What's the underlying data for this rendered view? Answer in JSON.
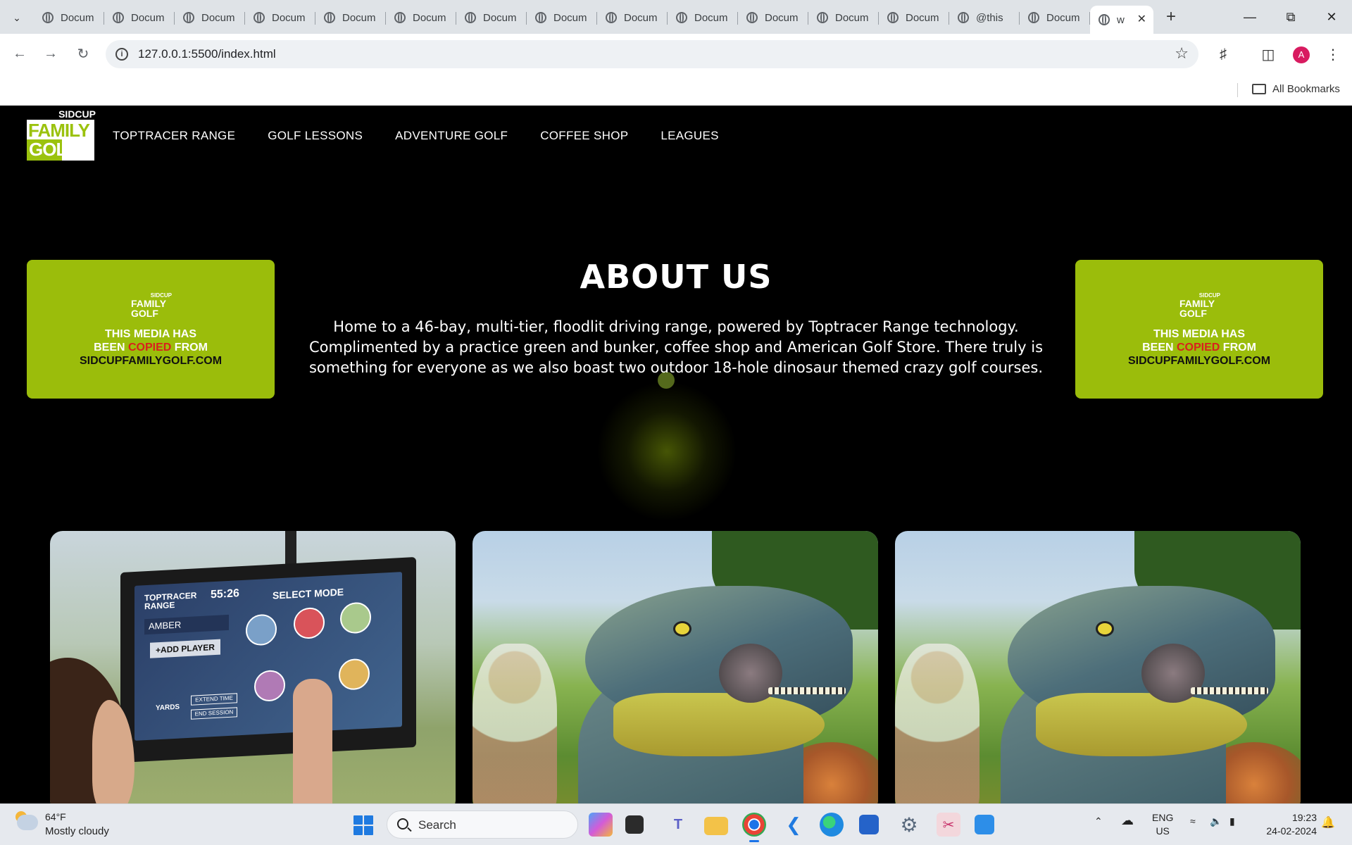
{
  "browser": {
    "tabs": [
      {
        "title": "Docum"
      },
      {
        "title": "Docum"
      },
      {
        "title": "Docum"
      },
      {
        "title": "Docum"
      },
      {
        "title": "Docum"
      },
      {
        "title": "Docum"
      },
      {
        "title": "Docum"
      },
      {
        "title": "Docum"
      },
      {
        "title": "Docum"
      },
      {
        "title": "Docum"
      },
      {
        "title": "Docum"
      },
      {
        "title": "Docum"
      },
      {
        "title": "Docum"
      },
      {
        "title": "@this"
      },
      {
        "title": "Docum"
      }
    ],
    "active_tab": {
      "title": "w"
    },
    "url": "127.0.0.1:5500/index.html",
    "profile_initial": "A",
    "bookmarks_label": "All Bookmarks"
  },
  "site": {
    "logo": {
      "top": "SIDCUP",
      "line1": "FAMILY",
      "line2": "GOLF"
    },
    "nav": [
      "TOPTRACER RANGE",
      "GOLF LESSONS",
      "ADVENTURE GOLF",
      "COFFEE SHOP",
      "LEAGUES"
    ],
    "promo": {
      "logo_top": "SIDCUP",
      "logo_line1": "FAMILY",
      "logo_line2": "GOLF",
      "line1": "THIS MEDIA HAS",
      "line2_a": "BEEN ",
      "line2_red": "COPIED",
      "line2_b": " FROM",
      "line3": "SIDCUPFAMILYGOLF.COM"
    },
    "about": {
      "heading": "ABOUT US",
      "body": "Home to a 46-bay, multi-tier, floodlit driving range, powered by Toptracer Range technology. Complimented by a practice green and bunker, coffee shop and American Golf Store. There truly is something for everyone as we also boast two outdoor 18-hole dinosaur themed crazy golf courses."
    },
    "kiosk": {
      "brand": "TOPTRACER RANGE",
      "time": "55:26",
      "mode": "SELECT MODE",
      "player": "AMBER",
      "add_player": "+ADD PLAYER",
      "yards": "YARDS",
      "extend": "EXTEND TIME",
      "end": "END SESSION"
    }
  },
  "taskbar": {
    "temperature": "64°F",
    "weather": "Mostly cloudy",
    "search_placeholder": "Search",
    "lang_1": "ENG",
    "lang_2": "US",
    "time": "19:23",
    "date": "24-02-2024"
  },
  "colors": {
    "brand_green": "#9bbd0b",
    "accent_red": "#d9201e"
  }
}
